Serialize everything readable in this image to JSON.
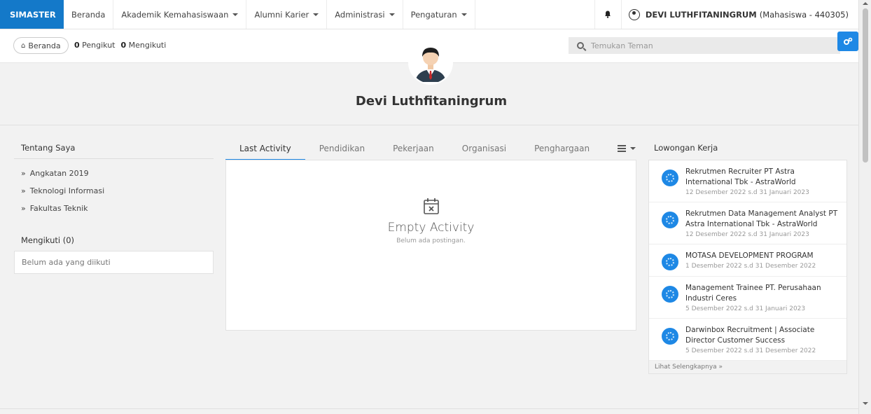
{
  "nav": {
    "brand": "SIMASTER",
    "items": [
      {
        "label": "Beranda",
        "dropdown": false
      },
      {
        "label": "Akademik Kemahasiswaan",
        "dropdown": true
      },
      {
        "label": "Alumni Karier",
        "dropdown": true
      },
      {
        "label": "Administrasi",
        "dropdown": true
      },
      {
        "label": "Pengaturan",
        "dropdown": true
      }
    ],
    "user_name": "DEVI LUTHFITANINGRUM",
    "user_role": "(Mahasiswa - 440305)"
  },
  "profile_bar": {
    "home_label": "Beranda",
    "followers_count": "0",
    "followers_label": "Pengikut",
    "following_count": "0",
    "following_label": "Mengikuti",
    "search_placeholder": "Temukan Teman"
  },
  "profile": {
    "name": "Devi Luthfitaningrum"
  },
  "about": {
    "title": "Tentang Saya",
    "items": [
      "Angkatan 2019",
      "Teknologi Informasi",
      "Fakultas Teknik"
    ]
  },
  "following": {
    "title": "Mengikuti (0)",
    "empty": "Belum ada yang diikuti"
  },
  "tabs": [
    {
      "label": "Last Activity",
      "active": true
    },
    {
      "label": "Pendidikan",
      "active": false
    },
    {
      "label": "Pekerjaan",
      "active": false
    },
    {
      "label": "Organisasi",
      "active": false
    },
    {
      "label": "Penghargaan",
      "active": false
    }
  ],
  "activity": {
    "empty_title": "Empty Activity",
    "empty_sub": "Belum ada postingan."
  },
  "jobs": {
    "title": "Lowongan Kerja",
    "items": [
      {
        "title": "Rekrutmen Recruiter PT Astra International Tbk - AstraWorld",
        "date": "12 Desember 2022 s.d 31 Januari 2023"
      },
      {
        "title": "Rekrutmen Data Management Analyst PT Astra International Tbk - AstraWorld",
        "date": "12 Desember 2022 s.d 31 Januari 2023"
      },
      {
        "title": "MOTASA DEVELOPMENT PROGRAM",
        "date": "1 Desember 2022 s.d 31 Desember 2022"
      },
      {
        "title": "Management Trainee PT. Perusahaan Industri Ceres",
        "date": "5 Desember 2022 s.d 31 Januari 2023"
      },
      {
        "title": "Darwinbox Recruitment | Associate Director Customer Success",
        "date": "5 Desember 2022 s.d 31 Desember 2022"
      }
    ],
    "see_more": "Lihat Selengkapnya »"
  },
  "colors": {
    "brand": "#1479c9",
    "accent": "#1e88e5",
    "background": "#f2f2f2"
  },
  "icons": {
    "home": "home-icon",
    "bell": "bell-icon",
    "user": "user-circle-icon",
    "search": "search-icon",
    "gears": "gears-icon",
    "calendar_x": "calendar-times-icon",
    "menu": "hamburger-menu-icon"
  }
}
